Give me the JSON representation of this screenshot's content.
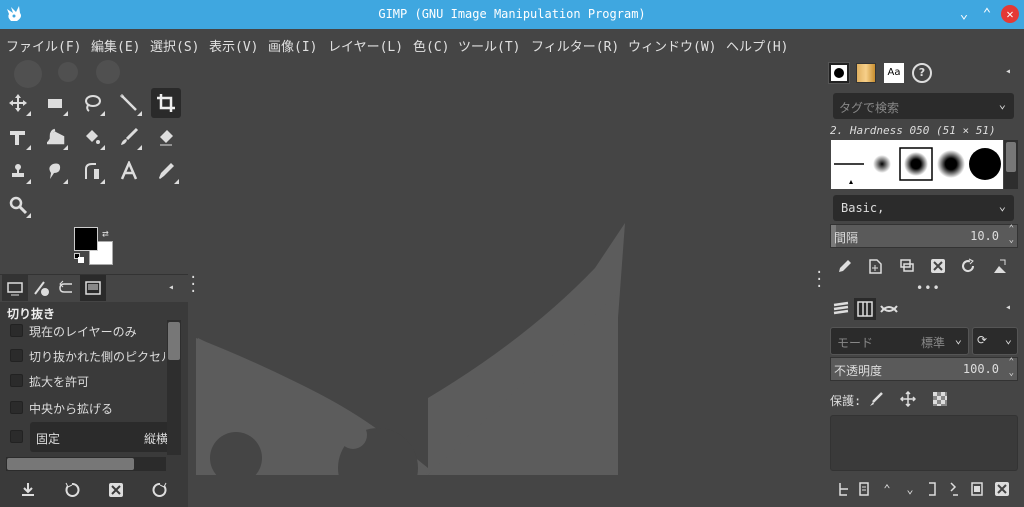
{
  "window": {
    "title": "GIMP (GNU Image Manipulation Program)"
  },
  "menu": [
    "ファイル(F)",
    "編集(E)",
    "選択(S)",
    "表示(V)",
    "画像(I)",
    "レイヤー(L)",
    "色(C)",
    "ツール(T)",
    "フィルター(R)",
    "ウィンドウ(W)",
    "ヘルプ(H)"
  ],
  "tool_options": {
    "title": "切り抜き",
    "options": [
      "現在のレイヤーのみ",
      "切り抜かれた側のピクセルの",
      "拡大を許可",
      "中央から拡げる"
    ],
    "fixed_label": "固定",
    "fixed_value": "縦横"
  },
  "brushes": {
    "tag_placeholder": "タグで検索",
    "selected_name": "2. Hardness 050 (51 × 51)",
    "preset": "Basic,",
    "spacing_label": "間隔",
    "spacing_value": "10.0"
  },
  "layers": {
    "mode_label": "モード",
    "mode_value": "標準",
    "opacity_label": "不透明度",
    "opacity_value": "100.0",
    "protect_label": "保護:"
  },
  "colors": {
    "titlebar": "#3fa7e0",
    "background": "#454545",
    "wilber": "#5c5c5c",
    "close": "#e53935"
  }
}
